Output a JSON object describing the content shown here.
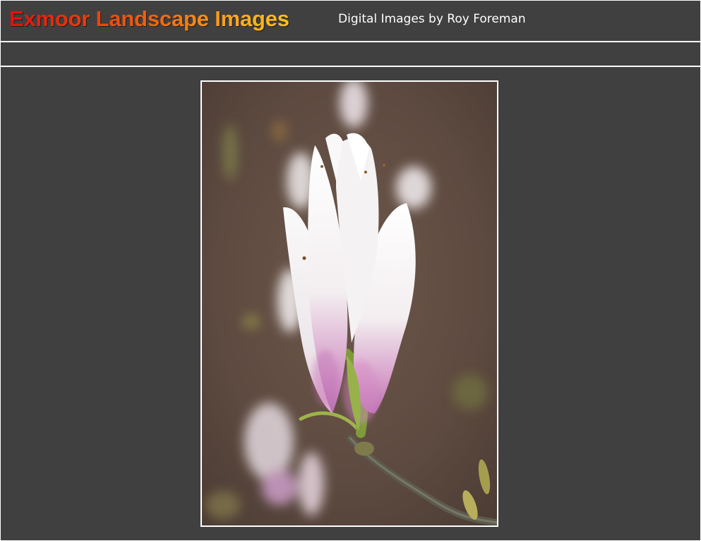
{
  "header": {
    "site_title": "Exmoor Landscape Images",
    "subtitle": "Digital Images by Roy Foreman"
  },
  "photo": {
    "subject": "white-magnolia-bud-photo"
  },
  "colors": {
    "page_background": "#404040",
    "rule": "#ffffff",
    "subtitle_text": "#ffffff",
    "title_gradient_start": "#e01010",
    "title_gradient_end": "#fcc21a"
  }
}
